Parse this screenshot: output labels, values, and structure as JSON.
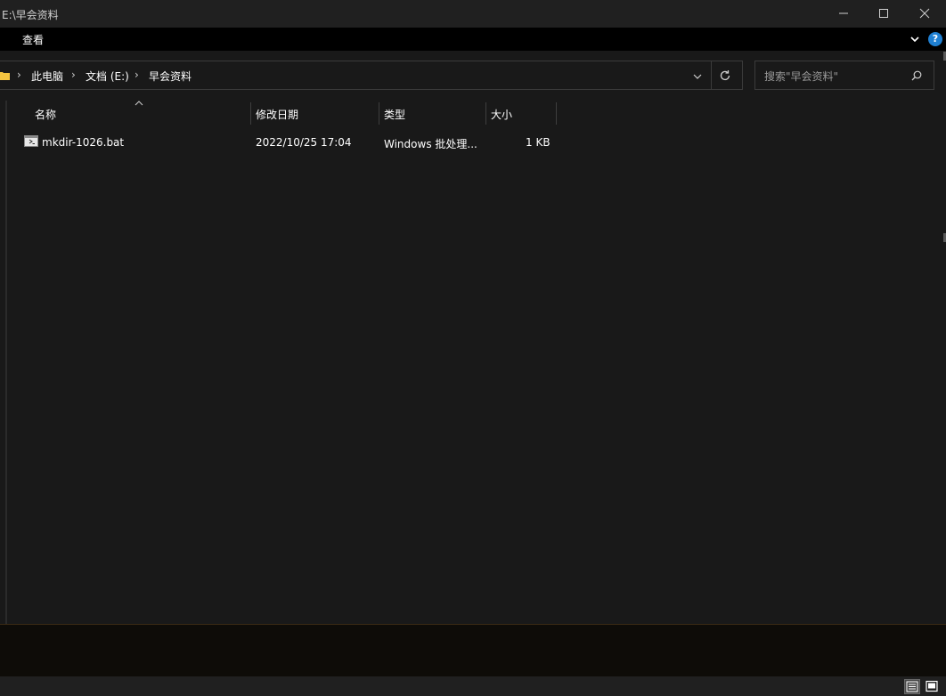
{
  "window": {
    "title": "E:\\早会资料"
  },
  "menu": {
    "view_label": "查看",
    "help_label": "?"
  },
  "address": {
    "crumbs": [
      "此电脑",
      "文档 (E:)",
      "早会资料"
    ]
  },
  "search": {
    "placeholder": "搜索\"早会资料\""
  },
  "columns": {
    "name": "名称",
    "modified": "修改日期",
    "type": "类型",
    "size": "大小"
  },
  "files": [
    {
      "name": "mkdir-1026.bat",
      "modified": "2022/10/25 17:04",
      "type": "Windows 批处理...",
      "size": "1 KB",
      "icon": "batch-file-icon"
    }
  ],
  "colors": {
    "background": "#191919",
    "titlebar": "#202020",
    "menubar": "#000000",
    "folder": "#f3c340",
    "help": "#1f7fd1"
  }
}
